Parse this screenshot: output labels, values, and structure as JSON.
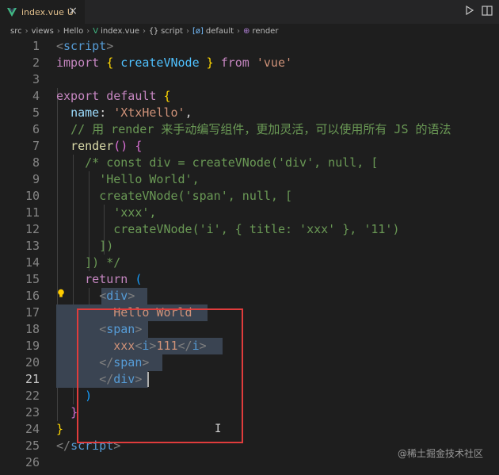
{
  "tab": {
    "title": "index.vue",
    "status": "U",
    "close": "×"
  },
  "breadcrumb": [
    "src",
    "views",
    "Hello",
    "index.vue",
    "script",
    "default",
    "render"
  ],
  "breadcrumb_icons": {
    "vue": "V",
    "script": "{}",
    "default": "[ø]",
    "render": "⊕"
  },
  "line_numbers": [
    "1",
    "2",
    "3",
    "4",
    "5",
    "6",
    "7",
    "8",
    "9",
    "10",
    "11",
    "12",
    "13",
    "14",
    "15",
    "16",
    "17",
    "18",
    "19",
    "20",
    "21",
    "22",
    "23",
    "24",
    "25",
    "26"
  ],
  "code": {
    "l1": {
      "open": "<",
      "tag": "script",
      "close": ">"
    },
    "l2": {
      "kw": "import",
      "b1": "{",
      "name": "createVNode",
      "b2": "}",
      "from": "from",
      "str": "'vue'"
    },
    "l4": {
      "kw1": "export",
      "kw2": "default",
      "brace": "{"
    },
    "l5": {
      "prop": "name",
      "colon": ": ",
      "str": "'XtxHello'",
      "comma": ","
    },
    "l6": {
      "comment": "// 用 render 来手动编写组件，更加灵活，可以使用所有 JS 的语法"
    },
    "l7": {
      "fn": "render",
      "parens": "()",
      "brace": "{"
    },
    "l8": {
      "comment": "/* const div = createVNode('div', null, ["
    },
    "l9": {
      "comment": "'Hello World',"
    },
    "l10": {
      "comment": "createVNode('span', null, ["
    },
    "l11": {
      "comment": "'xxx',"
    },
    "l12": {
      "comment": "createVNode('i', { title: 'xxx' }, '11')"
    },
    "l13": {
      "comment": "])"
    },
    "l14": {
      "comment": "]) */"
    },
    "l15": {
      "kw": "return",
      "paren": "("
    },
    "l16": {
      "open": "<",
      "tag": "div",
      "close": ">"
    },
    "l17": {
      "text": "Hello World"
    },
    "l18": {
      "open": "<",
      "tag": "span",
      "close": ">"
    },
    "l19": {
      "text": "xxx",
      "open": "<",
      "tag": "i",
      "close": ">",
      "inner": "111",
      "eopen": "</",
      "etag": "i",
      "eclose": ">"
    },
    "l20": {
      "open": "</",
      "tag": "span",
      "close": ">"
    },
    "l21": {
      "open": "</",
      "tag": "div",
      "close": ">"
    },
    "l22": {
      "paren": ")"
    },
    "l23": {
      "brace": "}"
    },
    "l24": {
      "brace": "}"
    },
    "l25": {
      "open": "</",
      "tag": "script",
      "close": ">"
    }
  },
  "watermark": "@稀土掘金技术社区",
  "colors": {
    "highlight_box": "#e03c3c",
    "selection": "#3a4452",
    "background": "#1e1e1e"
  },
  "icons": [
    "vue-file-icon",
    "close-icon",
    "run-icon",
    "split-editor-icon",
    "lightbulb-icon",
    "text-cursor-icon"
  ]
}
